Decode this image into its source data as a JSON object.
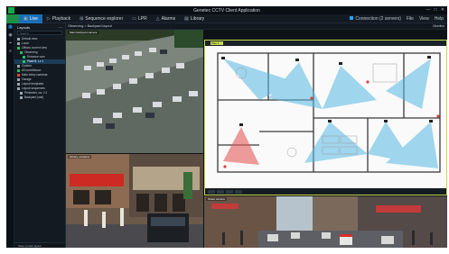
{
  "app": {
    "title": "Genetec CCTV Client Application",
    "window_controls": [
      "—",
      "□",
      "✕"
    ]
  },
  "menu": {
    "tabs": [
      {
        "label": "Live",
        "icon": "live-icon"
      },
      {
        "label": "Playback",
        "icon": "playback-icon"
      },
      {
        "label": "Sequence explorer",
        "icon": "sequence-icon"
      },
      {
        "label": "LPR",
        "icon": "lpr-icon"
      },
      {
        "label": "Alarms",
        "icon": "alarm-icon"
      },
      {
        "label": "Library",
        "icon": "library-icon"
      }
    ],
    "connection": "Connection (2 servers)",
    "right_items": [
      "File",
      "View",
      "Help"
    ]
  },
  "sidebar": {
    "title": "Layouts",
    "search_placeholder": "Search",
    "items": [
      {
        "label": "Default view",
        "color": "#9aa8b5"
      },
      {
        "label": "Local",
        "color": "#9aa8b5"
      },
      {
        "label": "Offices current view",
        "color": "#22c35e"
      },
      {
        "label": "Observing",
        "color": "#22c35e"
      },
      {
        "label": "Entrance cam",
        "color": "#22c35e"
      },
      {
        "label": "Plant B, Lv 1",
        "color": "#22c35e"
      },
      {
        "label": "Custom",
        "color": "#9aa8b5"
      },
      {
        "label": "All surveillance",
        "color": "#22c35e"
      },
      {
        "label": "Main lobby cameras",
        "color": "#e0453a"
      },
      {
        "label": "Garage",
        "color": "#9aa8b5"
      },
      {
        "label": "Layout templates",
        "color": "#9aa8b5"
      },
      {
        "label": "Layout sequences",
        "color": "#9aa8b5"
      },
      {
        "label": "Perimeter, cw, 2.2",
        "color": "#9aa8b5"
      },
      {
        "label": "Backyard (wat)",
        "color": "#9aa8b5"
      }
    ],
    "footer": "Save current layout"
  },
  "main": {
    "header": "Observing > Backyard layout",
    "header_right": "Monitor",
    "tile1_label": "Main backyard camera",
    "tile2_label": "Plan 1",
    "tile3_label": "Library, entrance",
    "tile4_label": "Street camera"
  },
  "colors": {
    "accent": "#1b6fb6",
    "brand": "#1e8f47",
    "plan_highlight": "#c8d94b",
    "coverage_blue": "#4fb5e0",
    "coverage_red": "#e45a5a"
  }
}
